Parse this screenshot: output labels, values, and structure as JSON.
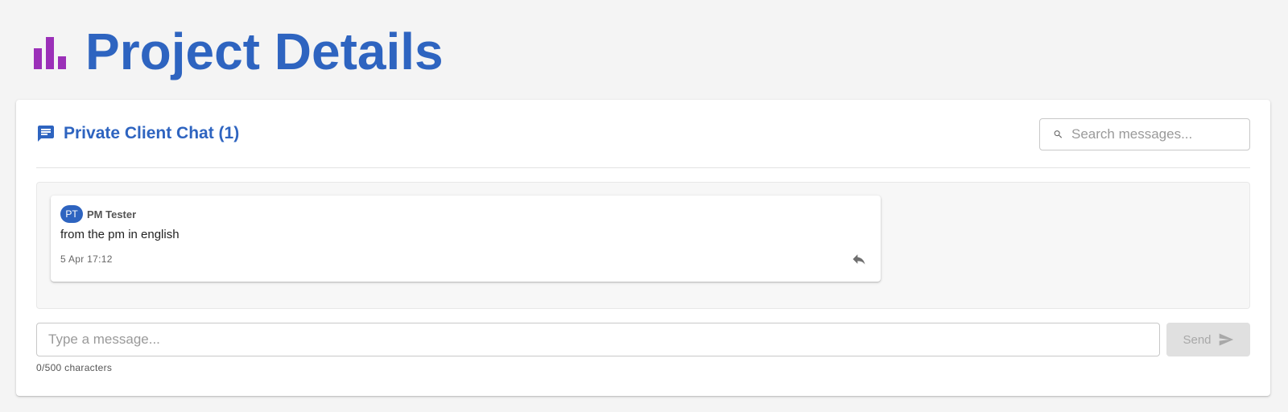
{
  "page": {
    "title": "Project Details",
    "logo_icon": "bar-chart-icon",
    "colors": {
      "brand_blue": "#2e64c0",
      "logo_purple": "#9b30b8",
      "background": "#f4f4f4"
    }
  },
  "chat": {
    "title": "Private Client Chat (1)",
    "title_icon": "chat-bubble-icon",
    "search": {
      "placeholder": "Search messages...",
      "value": "",
      "icon": "search-icon"
    },
    "messages": [
      {
        "avatar_initials": "PT",
        "sender": "PM Tester",
        "text": "from the pm in english",
        "time": "5 Apr 17:12",
        "action_icon": "reply-icon"
      }
    ],
    "composer": {
      "placeholder": "Type a message...",
      "value": "",
      "send_label": "Send",
      "send_icon": "send-icon",
      "char_count": "0/500 characters"
    }
  }
}
